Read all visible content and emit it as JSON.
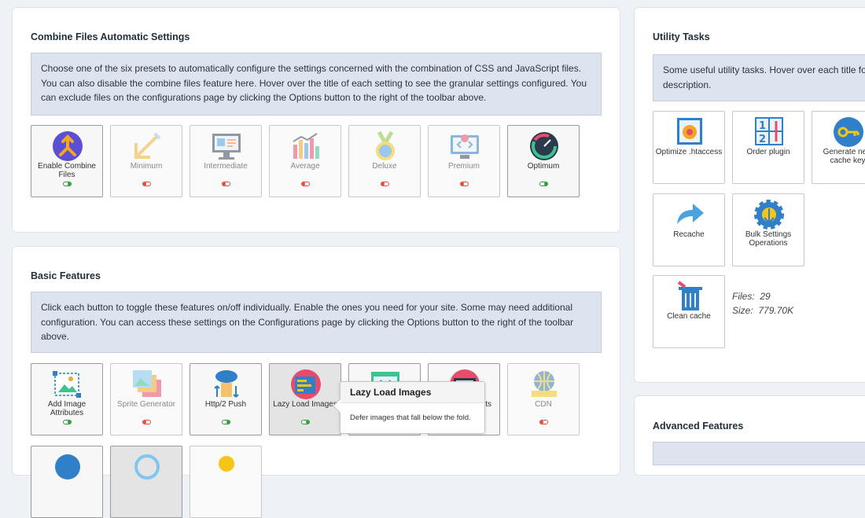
{
  "combine": {
    "title": "Combine Files Automatic Settings",
    "description": "Choose one of the six presets to automatically configure the settings concerned with the combination of CSS and JavaScript files. You can also disable the combine files feature here. Hover over the title of each setting to see the granular settings configured. You can exclude files on the configurations page by clicking the Options button to the right of the toolbar above.",
    "tiles": [
      {
        "label": "Enable Combine Files",
        "icon": "combine-files-icon",
        "state": "on"
      },
      {
        "label": "Minimum",
        "icon": "minimum-icon",
        "state": "off"
      },
      {
        "label": "Intermediate",
        "icon": "intermediate-icon",
        "state": "off"
      },
      {
        "label": "Average",
        "icon": "average-icon",
        "state": "off"
      },
      {
        "label": "Deluxe",
        "icon": "deluxe-medal-icon",
        "state": "off"
      },
      {
        "label": "Premium",
        "icon": "premium-code-icon",
        "state": "off"
      },
      {
        "label": "Optimum",
        "icon": "optimum-gauge-icon",
        "state": "on"
      }
    ]
  },
  "basic": {
    "title": "Basic Features",
    "description": "Click each button to toggle these features on/off individually. Enable the ones you need for your site. Some may need additional configuration. You can access these settings on the Configurations page by clicking the Options button to the right of the toolbar above.",
    "tiles": [
      {
        "label": "Add Image Attributes",
        "icon": "image-attributes-icon",
        "state": "on"
      },
      {
        "label": "Sprite Generator",
        "icon": "sprite-generator-icon",
        "state": "off"
      },
      {
        "label": "Http/2 Push",
        "icon": "http2-push-icon",
        "state": "on"
      },
      {
        "label": "Lazy Load Images",
        "icon": "lazy-load-icon",
        "state": "on"
      },
      {
        "label": "",
        "icon": "code-window-icon",
        "state": ""
      },
      {
        "label": "ts",
        "icon": "scripts-icon",
        "state": ""
      },
      {
        "label": "CDN",
        "icon": "cdn-icon",
        "state": "off"
      }
    ]
  },
  "tooltip": {
    "title": "Lazy Load Images",
    "body": "Defer images that fall below the fold."
  },
  "utility": {
    "title": "Utility Tasks",
    "description": "Some useful utility tasks. Hover over each title fo description.",
    "description_line1": "Some useful utility tasks. Hover over each title fo",
    "description_line2": "description.",
    "tiles": [
      {
        "label": "Optimize .htaccess",
        "icon": "htaccess-gear-icon"
      },
      {
        "label": "Order plugin",
        "icon": "order-plugin-icon"
      },
      {
        "label": "Generate new cache key",
        "icon": "cache-key-icon"
      },
      {
        "label": "Recache",
        "icon": "recache-arrow-icon"
      },
      {
        "label": "Bulk Settings Operations",
        "icon": "bulk-settings-gear-icon"
      },
      {
        "label": "Clean cache",
        "icon": "clean-cache-icon"
      }
    ],
    "files_label": "Files:",
    "files_value": "29",
    "size_label": "Size:",
    "size_value": "779.70K"
  },
  "advanced": {
    "title": "Advanced Features"
  },
  "colors": {
    "toggle_on": "#2e9a3a",
    "toggle_off": "#e04b3a",
    "info_bg": "#dde4f0"
  }
}
